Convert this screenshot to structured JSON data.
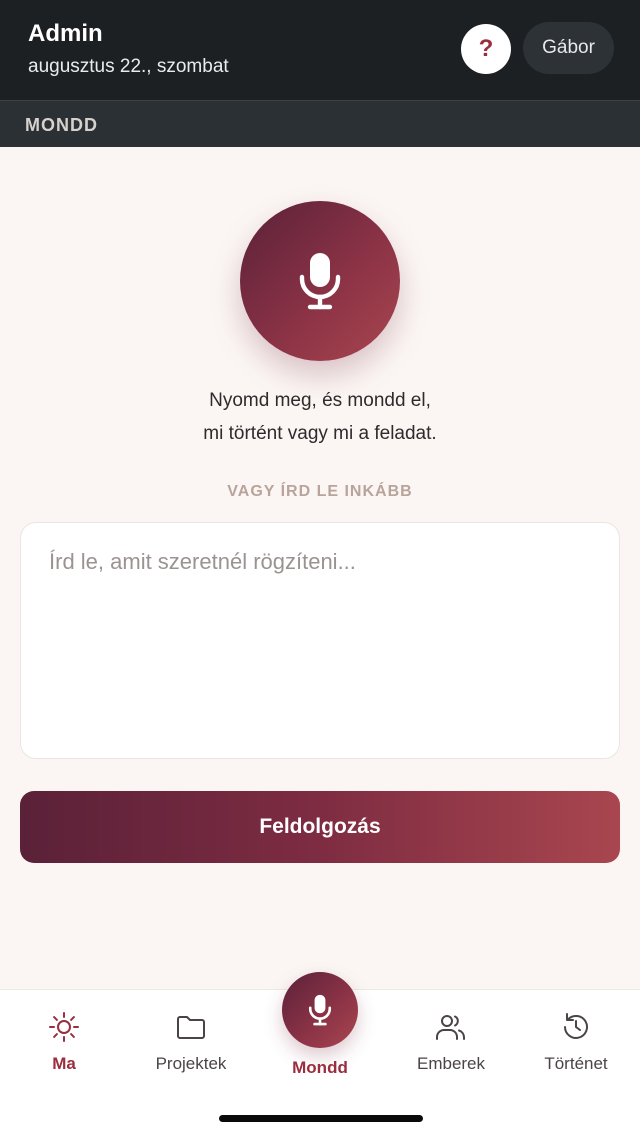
{
  "header": {
    "title": "Admin",
    "date": "augusztus 22., szombat",
    "help_label": "?",
    "user_label": "Gábor"
  },
  "section": {
    "title": "MONDD"
  },
  "main": {
    "instruction_line1": "Nyomd meg, és mondd el,",
    "instruction_line2": "mi történt vagy mi a feladat.",
    "alt_label": "VAGY ÍRD LE INKÁBB",
    "input": {
      "value": "",
      "placeholder": "Írd le, amit szeretnél rögzíteni..."
    },
    "submit_label": "Feldolgozás"
  },
  "nav": {
    "items": [
      {
        "label": "Ma",
        "icon": "sun-icon",
        "active": true
      },
      {
        "label": "Projektek",
        "icon": "folder-icon",
        "active": false
      },
      {
        "label": "Mondd",
        "icon": "microphone-icon",
        "active": false
      },
      {
        "label": "Emberek",
        "icon": "people-icon",
        "active": false
      },
      {
        "label": "Történet",
        "icon": "history-icon",
        "active": false
      }
    ]
  },
  "colors": {
    "accent": "#9a2d3e",
    "gradient_start": "#5a2138",
    "gradient_end": "#a9464f",
    "header_bg": "#1c2023",
    "page_bg": "#fbf6f4"
  }
}
